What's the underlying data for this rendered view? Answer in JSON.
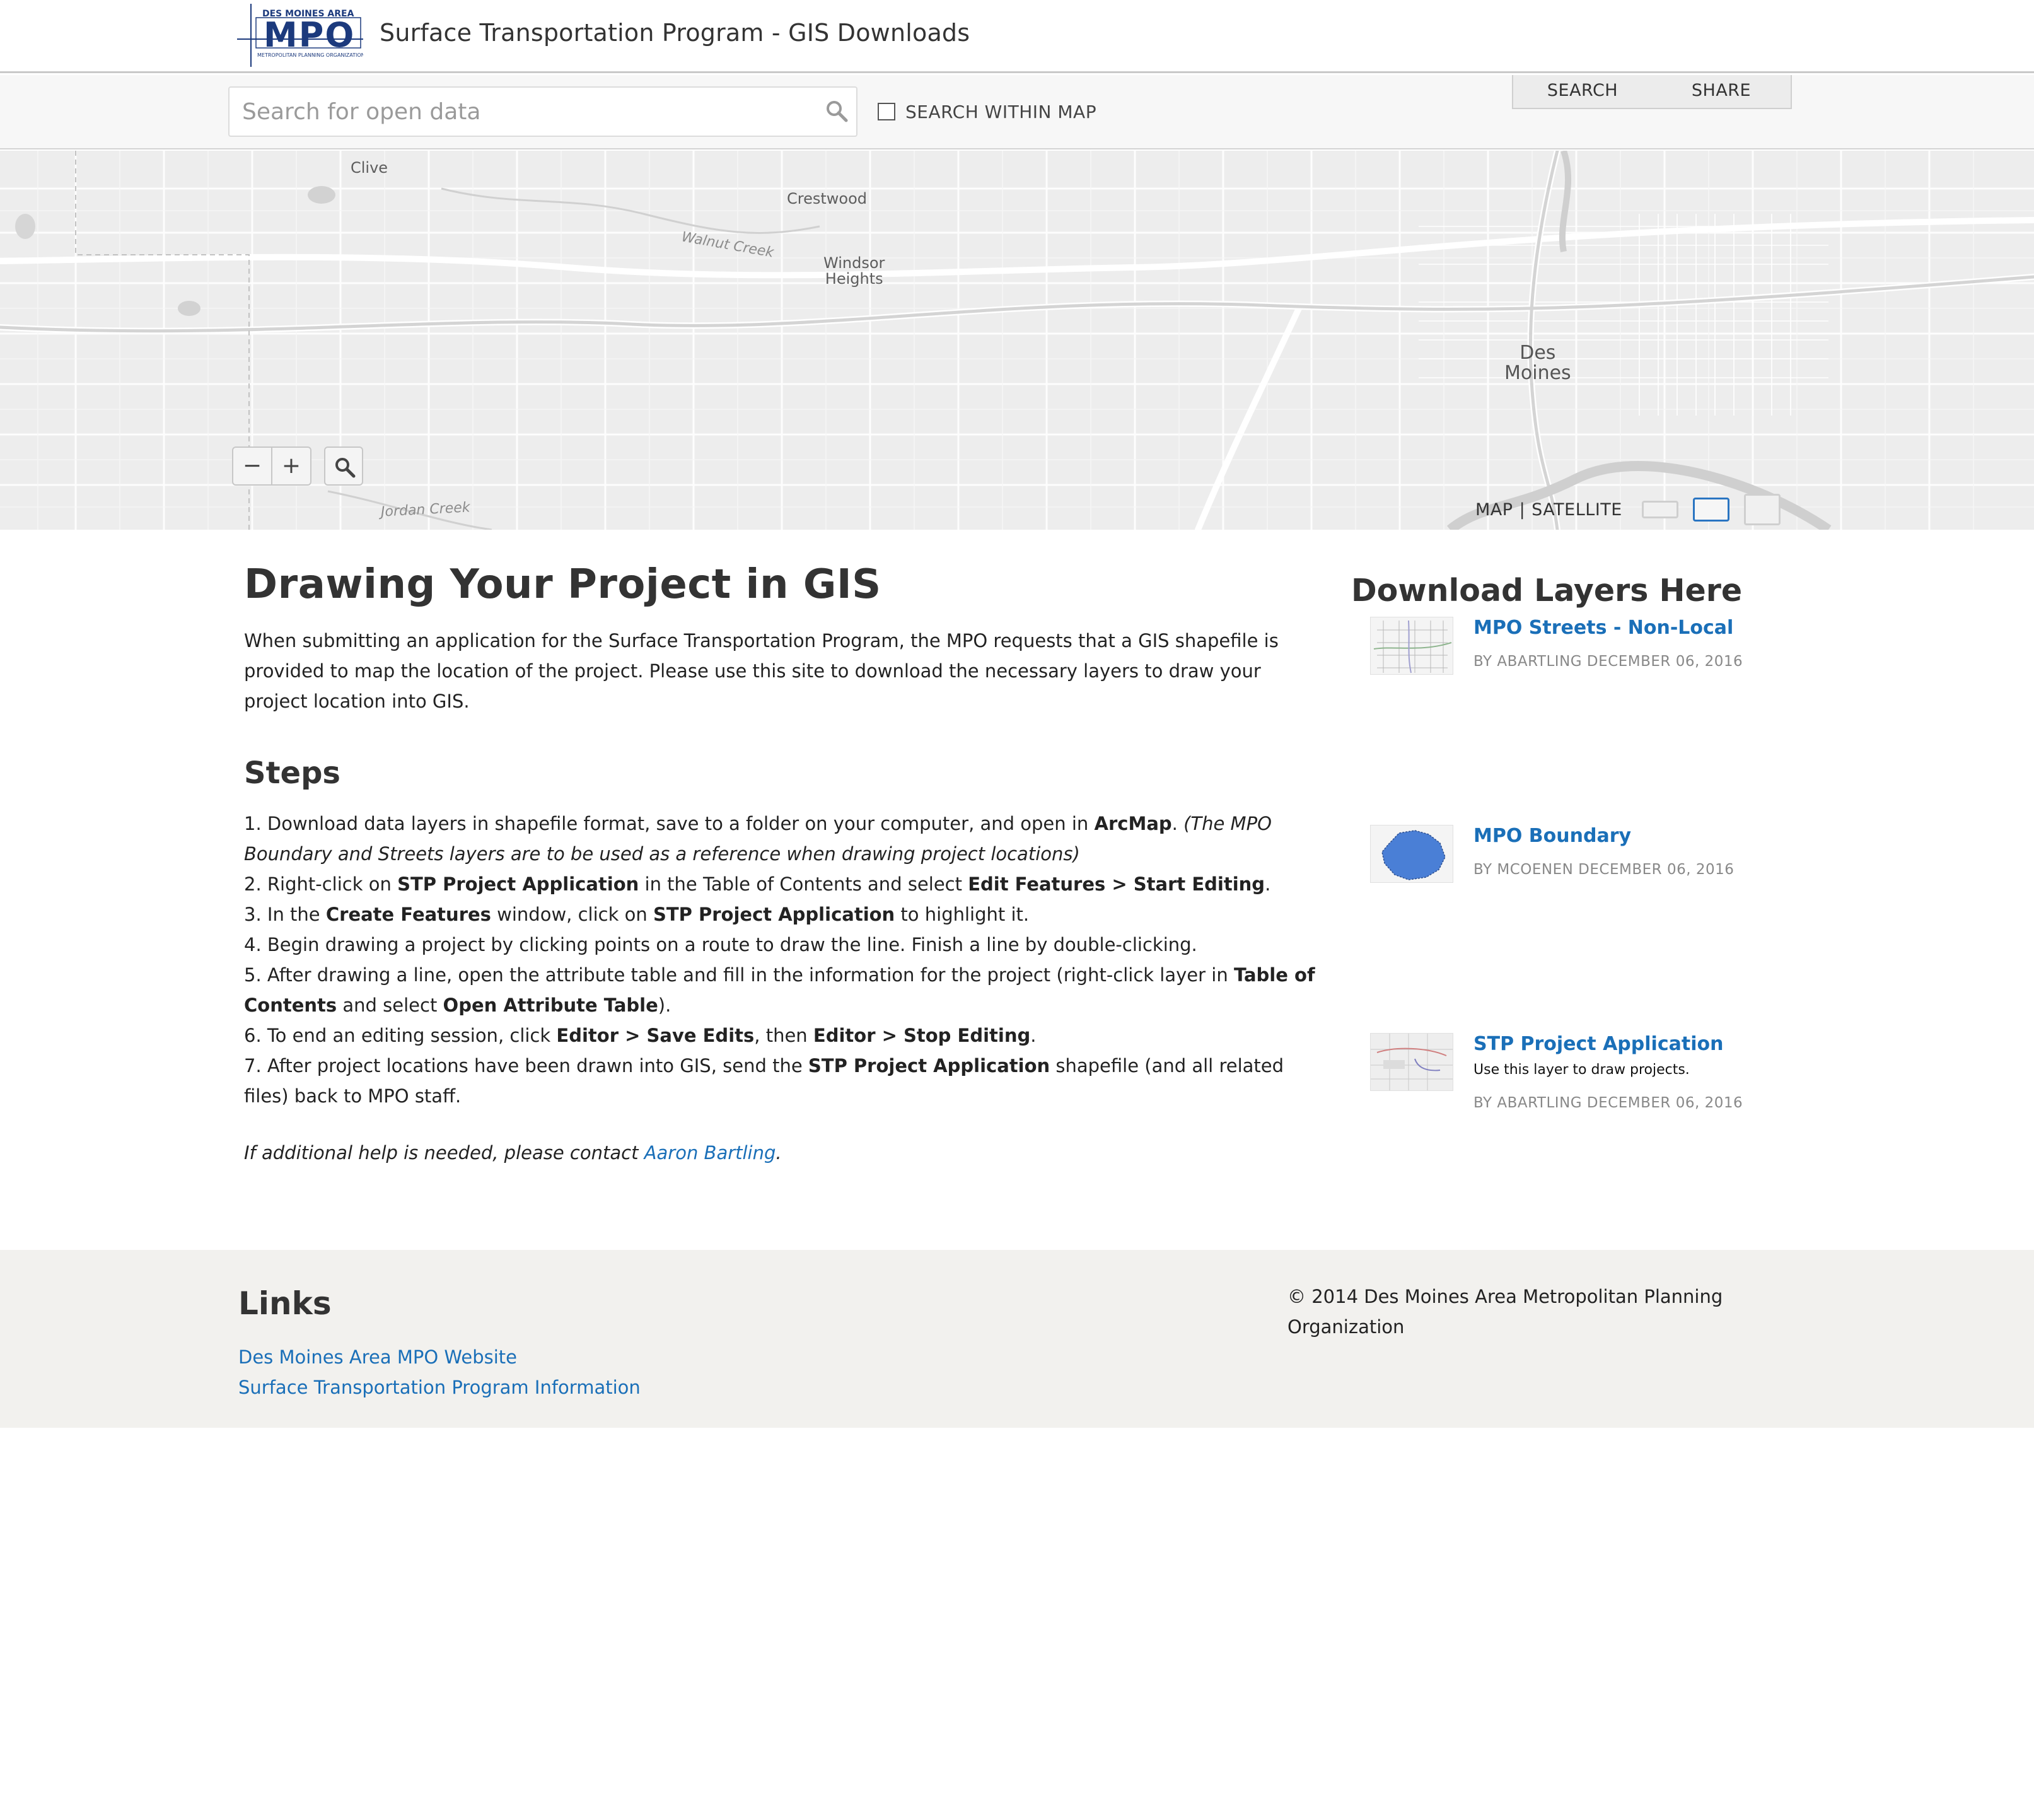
{
  "header": {
    "logo_text": "MPO",
    "logo_top": "DES MOINES AREA",
    "logo_bottom": "METROPOLITAN PLANNING ORGANIZATION",
    "title": "Surface Transportation Program - GIS Downloads"
  },
  "search": {
    "placeholder": "Search for open data",
    "value": "",
    "within_map_label": "SEARCH WITHIN MAP",
    "within_map_checked": false
  },
  "tabs": [
    "SEARCH",
    "SHARE"
  ],
  "map": {
    "labels": [
      {
        "text": "Clive",
        "kind": "place"
      },
      {
        "text": "Crestwood",
        "kind": "place"
      },
      {
        "text": "Windsor\nHeights",
        "kind": "place"
      },
      {
        "text": "Walnut Creek",
        "kind": "water"
      },
      {
        "text": "Des\nMoines",
        "kind": "city"
      },
      {
        "text": "Jordan Creek",
        "kind": "water"
      }
    ],
    "zoom_out_label": "−",
    "zoom_in_label": "+",
    "basemap_map_label": "MAP",
    "basemap_separator": "|",
    "basemap_satellite_label": "SATELLITE",
    "selected_basemap_index": 1
  },
  "main": {
    "title": "Drawing Your Project in GIS",
    "intro": "When submitting an application for the Surface Transportation Program, the MPO requests that a GIS shapefile is provided to map the location of the project. Please use this site to download the necessary layers to draw your project location into GIS.",
    "steps_title": "Steps",
    "steps": [
      [
        {
          "t": "1. Download data layers in shapefile format, save to a folder on your computer, and open in ",
          "s": "n"
        },
        {
          "t": "ArcMap",
          "s": "b"
        },
        {
          "t": ". ",
          "s": "n"
        },
        {
          "t": "(The MPO Boundary and Streets layers are to be used as a reference when drawing project locations)",
          "s": "i"
        }
      ],
      [
        {
          "t": "2. Right-click on ",
          "s": "n"
        },
        {
          "t": "STP Project Application",
          "s": "b"
        },
        {
          "t": " in the Table of Contents and select ",
          "s": "n"
        },
        {
          "t": "Edit Features > Start Editing",
          "s": "b"
        },
        {
          "t": ".",
          "s": "n"
        }
      ],
      [
        {
          "t": "3. In the ",
          "s": "n"
        },
        {
          "t": "Create Features",
          "s": "b"
        },
        {
          "t": " window, click on ",
          "s": "n"
        },
        {
          "t": "STP Project Application",
          "s": "b"
        },
        {
          "t": " to highlight it.",
          "s": "n"
        }
      ],
      [
        {
          "t": "4. Begin drawing a project by clicking points on a route to draw the line. Finish a line by double-clicking.",
          "s": "n"
        }
      ],
      [
        {
          "t": "5. After drawing a line, open the attribute table and fill in the information for the project (right-click layer in ",
          "s": "n"
        },
        {
          "t": "Table of Contents",
          "s": "b"
        },
        {
          "t": " and select ",
          "s": "n"
        },
        {
          "t": "Open Attribute Table",
          "s": "b"
        },
        {
          "t": ").",
          "s": "n"
        }
      ],
      [
        {
          "t": "6. To end an editing session, click ",
          "s": "n"
        },
        {
          "t": "Editor > Save Edits",
          "s": "b"
        },
        {
          "t": ", then ",
          "s": "n"
        },
        {
          "t": "Editor > Stop Editing",
          "s": "b"
        },
        {
          "t": ".",
          "s": "n"
        }
      ],
      [
        {
          "t": "7. After project locations have been drawn into GIS, send the ",
          "s": "n"
        },
        {
          "t": "STP Project Application",
          "s": "b"
        },
        {
          "t": " shapefile (and all related files) back to MPO staff.",
          "s": "n"
        }
      ]
    ],
    "help_prefix": "If additional help is needed, please contact ",
    "help_link": "Aaron Bartling",
    "help_suffix": "."
  },
  "sidebar": {
    "title": "Download Layers Here",
    "layers": [
      {
        "name": "MPO Streets - Non-Local",
        "description": "",
        "meta": "BY ABARTLING DECEMBER 06, 2016",
        "thumb": "streets-map-thumbnail"
      },
      {
        "name": "MPO Boundary",
        "description": "",
        "meta": "BY MCOENEN DECEMBER 06, 2016",
        "thumb": "boundary-polygon-thumbnail"
      },
      {
        "name": "STP Project Application",
        "description": "Use this layer to draw projects.",
        "meta": "BY ABARTLING DECEMBER 06, 2016",
        "thumb": "project-map-thumbnail"
      }
    ]
  },
  "footer": {
    "links_title": "Links",
    "links": [
      "Des Moines Area MPO Website",
      "Surface Transportation Program Information"
    ],
    "copyright": "© 2014 Des Moines Area Metropolitan Planning Organization"
  },
  "colors": {
    "link": "#1a6fb8",
    "logo_navy": "#1c3a7d",
    "boundary_fill": "#4a7fd6",
    "footer_bg": "#f2f1ee",
    "map_bg": "#ededed"
  }
}
